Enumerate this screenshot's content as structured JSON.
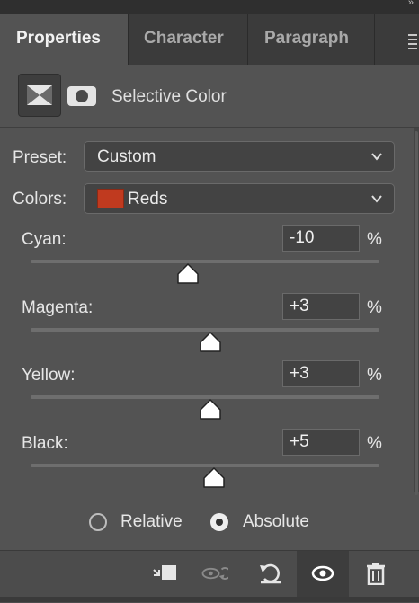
{
  "tabs": [
    {
      "label": "Properties",
      "active": true
    },
    {
      "label": "Character",
      "active": false
    },
    {
      "label": "Paragraph",
      "active": false
    }
  ],
  "adjustment": {
    "title": "Selective Color",
    "layer_icon": "selective-color-adjustment-icon",
    "mask_icon": "layer-mask-icon"
  },
  "preset": {
    "label": "Preset:",
    "value": "Custom"
  },
  "colors": {
    "label": "Colors:",
    "value": "Reds",
    "swatch_color": "#c03a1f"
  },
  "sliders": [
    {
      "label": "Cyan:",
      "value": "-10",
      "unit": "%",
      "min": -100,
      "max": 100
    },
    {
      "label": "Magenta:",
      "value": "+3",
      "unit": "%",
      "min": -100,
      "max": 100
    },
    {
      "label": "Yellow:",
      "value": "+3",
      "unit": "%",
      "min": -100,
      "max": 100
    },
    {
      "label": "Black:",
      "value": "+5",
      "unit": "%",
      "min": -100,
      "max": 100
    }
  ],
  "method": {
    "options": [
      "Relative",
      "Absolute"
    ],
    "selected": "Absolute"
  },
  "footer_icons": [
    "clip-to-layer-icon",
    "view-previous-state-icon",
    "reset-to-defaults-icon",
    "toggle-visibility-icon",
    "delete-icon"
  ]
}
